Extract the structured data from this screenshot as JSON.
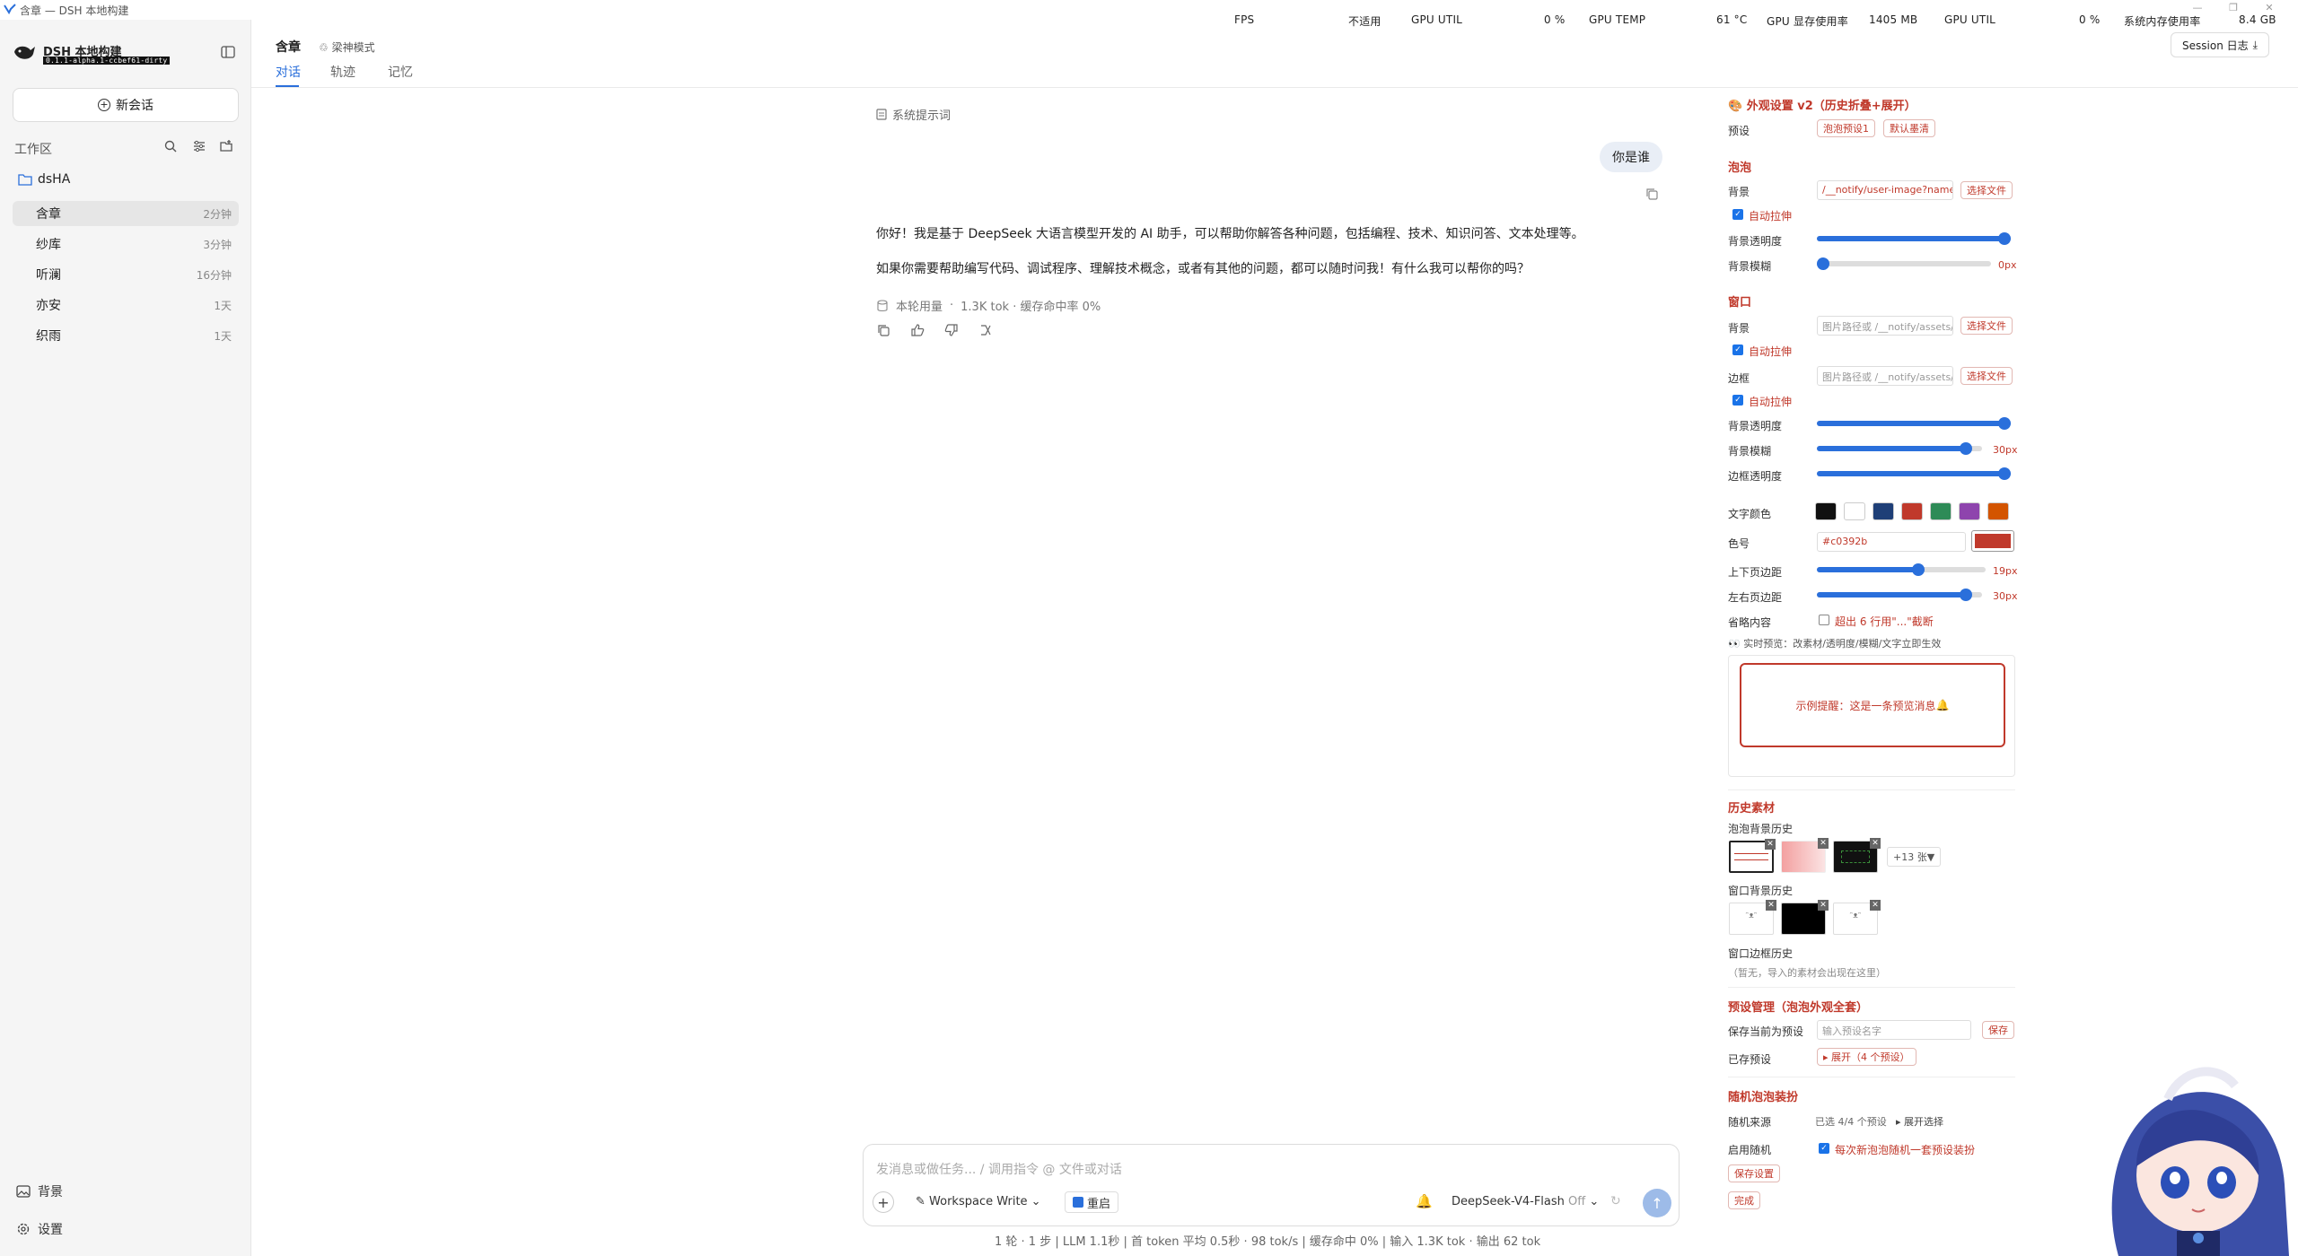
{
  "window": {
    "title": "含章 — DSH 本地构建",
    "stats": [
      {
        "label": "FPS",
        "value": "不适用"
      },
      {
        "label": "GPU UTIL",
        "value": "0 %"
      },
      {
        "label": "GPU TEMP",
        "value": "61 °C"
      },
      {
        "label": "GPU 显存使用率",
        "value": "1405 MB"
      },
      {
        "label": "GPU UTIL",
        "value": "0 %"
      },
      {
        "label": "系统内存使用率",
        "value": "8.4 GB"
      }
    ]
  },
  "sidebar": {
    "brand_title": "DSH 本地构建",
    "brand_version": "0.1.1-alpha.1-ccbef61-dirty",
    "new_chat": "新会话",
    "workspace_label": "工作区",
    "folder": "dsHA",
    "sessions": [
      {
        "name": "含章",
        "time": "2分钟"
      },
      {
        "name": "纱库",
        "time": "3分钟"
      },
      {
        "name": "听澜",
        "time": "16分钟"
      },
      {
        "name": "亦安",
        "time": "1天"
      },
      {
        "name": "织雨",
        "time": "1天"
      }
    ],
    "footer_background": "背景",
    "footer_settings": "设置"
  },
  "header": {
    "title": "含章",
    "mode": "梁神模式",
    "tabs": [
      "对话",
      "轨迹",
      "记忆"
    ],
    "session_log": "Session 日志"
  },
  "chat": {
    "system_prompt": "系统提示词",
    "user_message": "你是谁",
    "ai_paragraphs": [
      "你好！我是基于 DeepSeek 大语言模型开发的 AI 助手，可以帮助你解答各种问题，包括编程、技术、知识问答、文本处理等。",
      "如果你需要帮助编写代码、调试程序、理解技术概念，或者有其他的问题，都可以随时问我！有什么我可以帮你的吗？"
    ],
    "usage_label": "本轮用量",
    "usage_detail": "1.3K tok · 缓存命中率 0%"
  },
  "composer": {
    "placeholder": "发消息或做任务... / 调用指令 @ 文件或对话",
    "workspace_write": "Workspace Write",
    "restart": "重启",
    "model": "DeepSeek-V4-Flash",
    "model_state": "Off",
    "footer_stats": "1 轮 · 1 步   |   LLM 1.1秒   |   首 token 平均 0.5秒 · 98 tok/s   |   缓存命中 0%   |   输入 1.3K tok · 输出 62 tok"
  },
  "panel": {
    "title": "外观设置 v2（历史折叠+展开）",
    "preset_label": "预设",
    "presets": [
      "泡泡预设1",
      "默认墨清"
    ],
    "bubble_section": "泡泡",
    "bg_label": "背景",
    "bubble_bg_value": "/__notify/user-image?name=",
    "choose_file": "选择文件",
    "auto_stretch": "自动拉伸",
    "bg_opacity": "背景透明度",
    "bg_blur": "背景模糊",
    "bubble_blur_value": "0px",
    "window_section": "窗口",
    "window_bg_placeholder": "图片路径或 /__notify/assets/...",
    "border_label": "边框",
    "border_placeholder": "图片路径或 /__notify/assets/...",
    "window_blur_value": "30px",
    "border_opacity": "边框透明度",
    "text_color": "文字颜色",
    "swatches": [
      "#111111",
      "#ffffff",
      "#1f3f77",
      "#c0392b",
      "#2e8b57",
      "#8e44ad",
      "#d35400"
    ],
    "hex_label": "色号",
    "hex_value": "#c0392b",
    "accent_color": "#c0392b",
    "v_margin": "上下页边距",
    "v_margin_value": "19px",
    "h_margin": "左右页边距",
    "h_margin_value": "30px",
    "truncate_label": "省略内容",
    "truncate_option": "超出 6 行用\"...\"截断",
    "live_preview": "实时预览：改素材/透明度/模糊/文字立即生效",
    "preview_text": "示例提醒：这是一条预览消息",
    "history_section": "历史素材",
    "bubble_history": "泡泡背景历史",
    "more_count": "+13 张",
    "window_history": "窗口背景历史",
    "border_history": "窗口边框历史",
    "border_history_empty": "（暂无，导入的素材会出现在这里）",
    "preset_mgmt": "预设管理（泡泡外观全套）",
    "save_as_preset": "保存当前为预设",
    "preset_name_placeholder": "输入预设名字",
    "save": "保存",
    "saved_presets": "已存预设",
    "expand_presets": "▸ 展开（4 个预设）",
    "random_section": "随机泡泡装扮",
    "random_source": "随机来源",
    "random_source_value": "已选 4/4 个预设",
    "expand_select": "▸ 展开选择",
    "enable_random": "启用随机",
    "enable_random_desc": "每次新泡泡随机一套预设装扮",
    "save_settings": "保存设置",
    "done": "完成",
    "slider_levels": {
      "bubble_opacity": 1.0,
      "bubble_blur": 0.0,
      "window_opacity": 1.0,
      "window_blur": 0.9,
      "border_opacity": 1.0,
      "v_margin": 0.6,
      "h_margin": 0.9
    }
  }
}
